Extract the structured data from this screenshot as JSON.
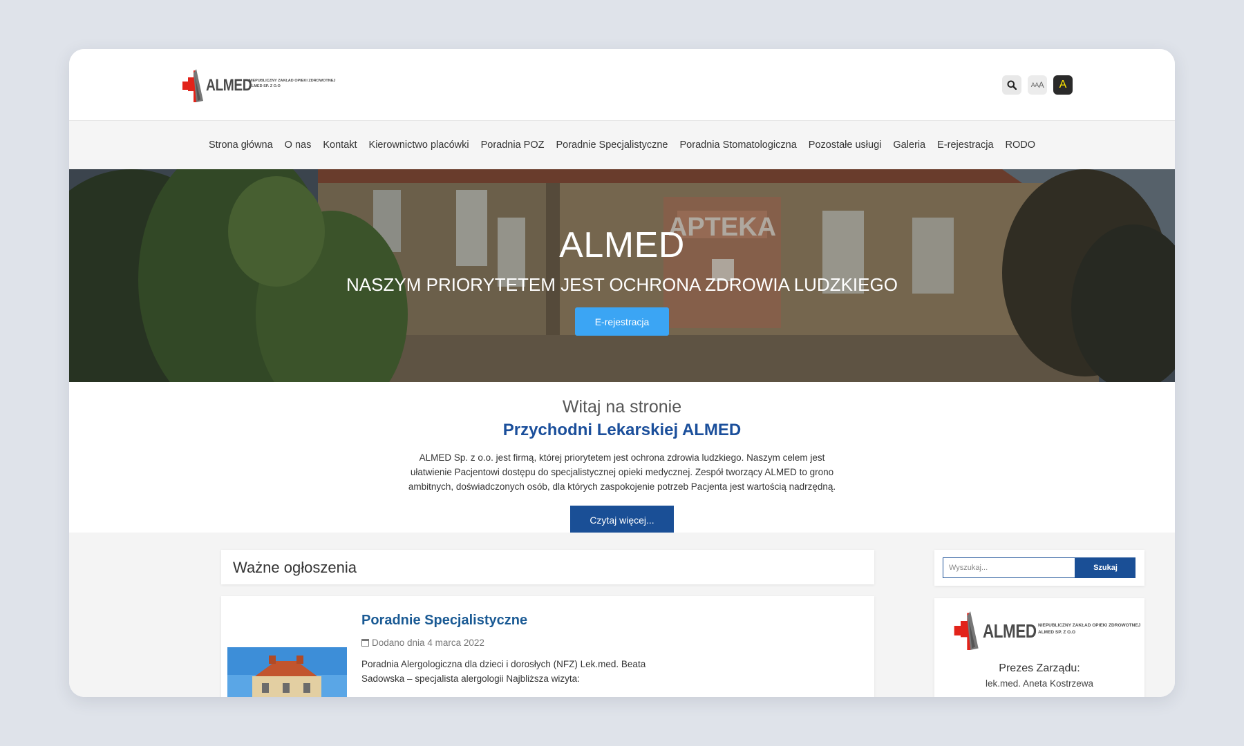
{
  "header": {
    "logo_text": "ALMED",
    "logo_subtitle_line1": "NIEPUBLICZNY ZAKŁAD OPIEKI ZDROWOTNEJ",
    "logo_subtitle_line2": "ALMED SP. Z O.O",
    "tools": {
      "search_icon": "search-icon",
      "font_size_label_small": "AA",
      "font_size_label_big": "A",
      "contrast_label": "A"
    }
  },
  "nav": {
    "items": [
      {
        "label": "Strona główna"
      },
      {
        "label": "O nas"
      },
      {
        "label": "Kontakt"
      },
      {
        "label": "Kierownictwo placówki"
      },
      {
        "label": "Poradnia POZ"
      },
      {
        "label": "Poradnie Specjalistyczne"
      },
      {
        "label": "Poradnia Stomatologiczna"
      },
      {
        "label": "Pozostałe usługi"
      },
      {
        "label": "Galeria"
      },
      {
        "label": "E-rejestracja"
      },
      {
        "label": "RODO"
      }
    ]
  },
  "hero": {
    "title": "ALMED",
    "subtitle": "NASZYM PRIORYTETEM JEST OCHRONA ZDROWIA LUDZKIEGO",
    "button_label": "E-rejestracja",
    "sign_text": "APTEKA"
  },
  "welcome": {
    "line1": "Witaj na stronie",
    "line2": "Przychodni Lekarskiej ALMED",
    "text": "ALMED Sp. z o.o. jest firmą, której priorytetem jest ochrona zdrowia ludzkiego. Naszym celem jest ułatwienie Pacjentowi dostępu do specjalistycznej opieki medycznej. Zespół tworzący ALMED to grono ambitnych, doświadczonych osób, dla których zaspokojenie potrzeb Pacjenta jest wartością nadrzędną.",
    "button_label": "Czytaj więcej..."
  },
  "notices": {
    "heading": "Ważne ogłoszenia",
    "post": {
      "title": "Poradnie Specjalistyczne",
      "date": "Dodano dnia 4 marca 2022",
      "excerpt": "Poradnia Alergologiczna dla dzieci i dorosłych (NFZ) Lek.med. Beata Sadowska – specjalista alergologii Najbliższa wizyta:"
    }
  },
  "sidebar": {
    "search_placeholder": "Wyszukaj...",
    "search_button": "Szukaj",
    "role": "Prezes Zarządu:",
    "person": "lek.med. Aneta Kostrzewa"
  },
  "colors": {
    "primary_blue": "#1a4f96",
    "hero_button": "#3ba5f4",
    "title_blue": "#1b4f9b",
    "logo_red": "#e2231a",
    "contrast_yellow": "#ffe600"
  }
}
